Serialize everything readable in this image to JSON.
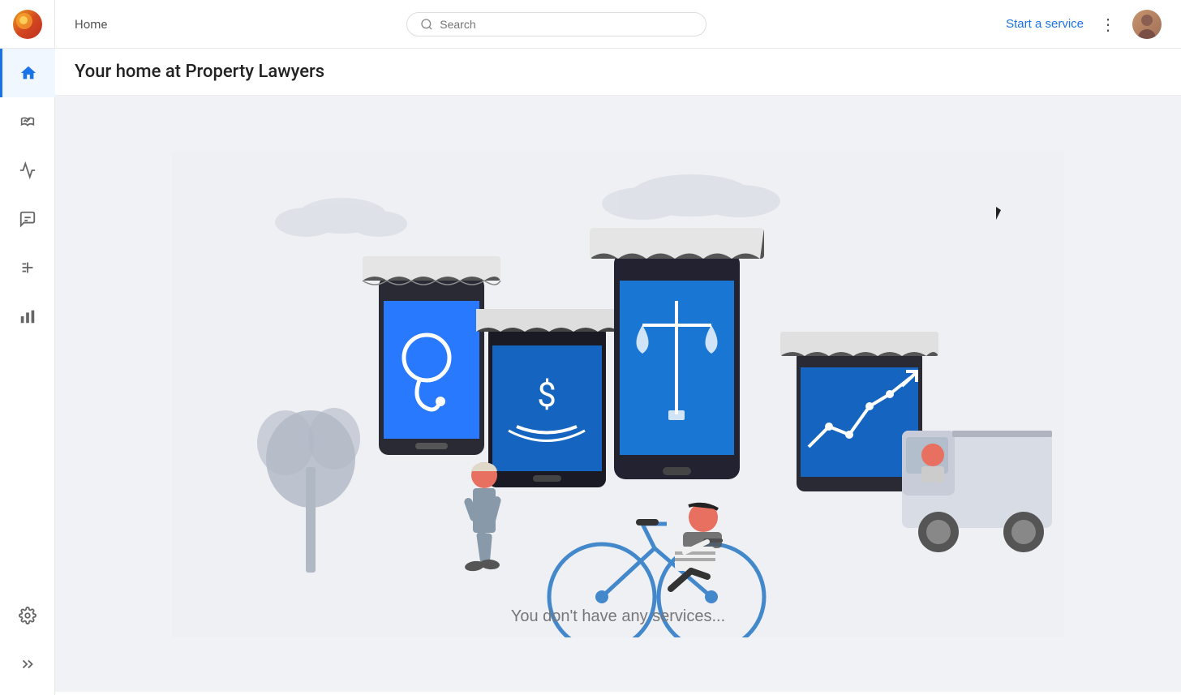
{
  "header": {
    "home_label": "Home",
    "search_placeholder": "Search",
    "start_service_label": "Start a service"
  },
  "page": {
    "title": "Your home at Property Lawyers",
    "bottom_text": "You don't have any services..."
  },
  "sidebar": {
    "items": [
      {
        "id": "home",
        "icon": "home-icon",
        "active": true
      },
      {
        "id": "handshake",
        "icon": "handshake-icon",
        "active": false
      },
      {
        "id": "activity",
        "icon": "activity-icon",
        "active": false
      },
      {
        "id": "chat",
        "icon": "chat-icon",
        "active": false
      },
      {
        "id": "add-list",
        "icon": "add-list-icon",
        "active": false
      },
      {
        "id": "bar-chart",
        "icon": "bar-chart-icon",
        "active": false
      }
    ],
    "bottom_items": [
      {
        "id": "settings",
        "icon": "settings-icon"
      },
      {
        "id": "expand",
        "icon": "expand-icon"
      }
    ]
  }
}
